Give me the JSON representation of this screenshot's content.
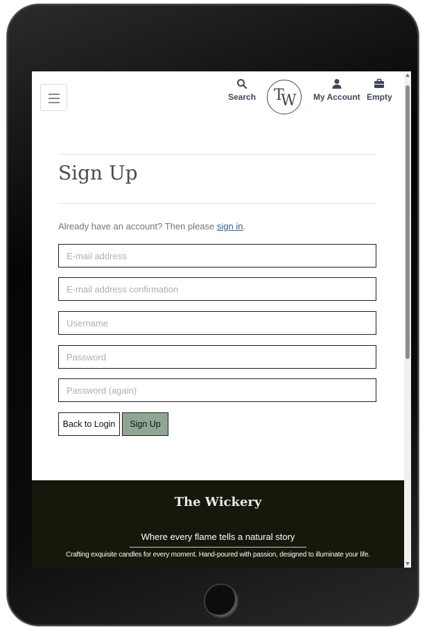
{
  "header": {
    "search_label": "Search",
    "account_label": "My Account",
    "cart_label": "Empty",
    "logo_t": "T",
    "logo_w": "W"
  },
  "signup": {
    "title": "Sign Up",
    "signin_prefix": "Already have an account? Then please ",
    "signin_link": "sign in",
    "signin_suffix": ".",
    "fields": {
      "email": {
        "placeholder": "E-mail address",
        "value": ""
      },
      "email_confirm": {
        "placeholder": "E-mail address confirmation",
        "value": ""
      },
      "username": {
        "placeholder": "Username",
        "value": ""
      },
      "password": {
        "placeholder": "Password",
        "value": ""
      },
      "password_again": {
        "placeholder": "Password (again)",
        "value": ""
      }
    },
    "back_button": "Back to Login",
    "submit_button": "Sign Up"
  },
  "footer": {
    "brand": "The Wickery",
    "tagline": "Where every flame tells a natural story",
    "description": "Crafting exquisite candles for every moment. Hand-poured with passion, designed to illuminate your life."
  },
  "colors": {
    "accent_button": "#8fa694",
    "footer_bg": "#17170b",
    "link": "#2f5e9a"
  },
  "icons": [
    "menu-icon",
    "search-icon",
    "user-icon",
    "briefcase-icon"
  ]
}
